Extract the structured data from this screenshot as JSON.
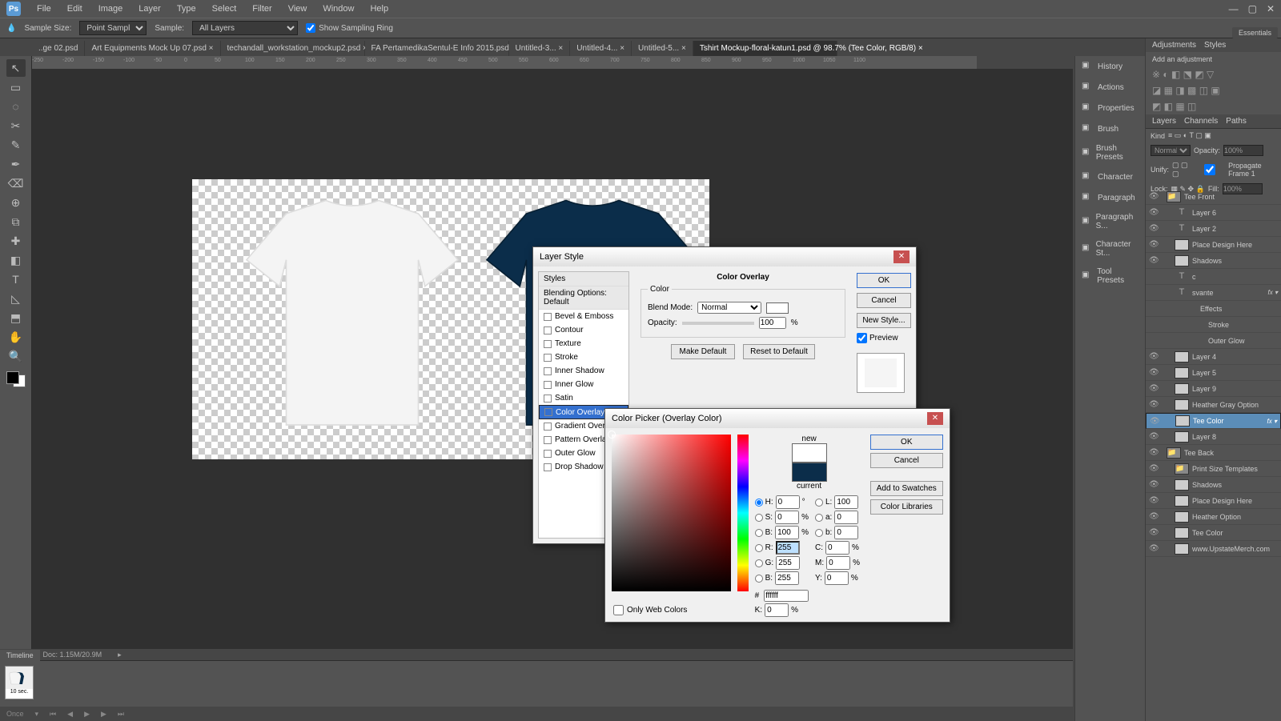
{
  "app": {
    "logo": "Ps"
  },
  "menu": [
    "File",
    "Edit",
    "Image",
    "Layer",
    "Type",
    "Select",
    "Filter",
    "View",
    "Window",
    "Help"
  ],
  "essentials": "Essentials",
  "options": {
    "sample_size_label": "Sample Size:",
    "sample_size": "Point Sample",
    "sample_label": "Sample:",
    "sample": "All Layers",
    "show_ring": "Show Sampling Ring"
  },
  "tabs": [
    "..ge 02.psd",
    "Art Equipments Mock Up 07.psd ×",
    "techandall_workstation_mockup2.psd ×",
    "FA PertamedikaSentul-E Info 2015.psd ×",
    "Untitled-3... ×",
    "Untitled-4... ×",
    "Untitled-5... ×",
    "Tshirt Mockup-floral-katun1.psd @ 98.7% (Tee Color, RGB/8) ×"
  ],
  "active_tab": 7,
  "ruler": [
    "-250",
    "-200",
    "-150",
    "-100",
    "-50",
    "0",
    "50",
    "100",
    "150",
    "200",
    "250",
    "300",
    "350",
    "400",
    "450",
    "500",
    "550",
    "600",
    "650",
    "700",
    "750",
    "800",
    "850",
    "900",
    "950",
    "1000",
    "1050",
    "1100"
  ],
  "status": {
    "zoom": "98.7%",
    "doc": "Doc: 1.15M/20.9M"
  },
  "timeline": {
    "label": "Timeline",
    "frame_time": "10 sec.",
    "mode": "Once"
  },
  "panel_items": [
    "History",
    "Actions",
    "Properties",
    "Brush",
    "Brush Presets",
    "Character",
    "Paragraph",
    "Paragraph S...",
    "Character St...",
    "Tool Presets"
  ],
  "adj": {
    "tabs": [
      "Adjustments",
      "Styles"
    ],
    "add": "Add an adjustment"
  },
  "layers_tabs": [
    "Layers",
    "Channels",
    "Paths"
  ],
  "layer_hdr": {
    "kind": "Kind",
    "mode": "Normal",
    "opacity_label": "Opacity:",
    "opacity": "100%",
    "unify": "Unify:",
    "propagate": "Propagate Frame 1",
    "lock": "Lock:",
    "fill_label": "Fill:",
    "fill": "100%"
  },
  "layers": [
    {
      "eye": "👁",
      "type": "folder",
      "name": "Tee Front",
      "indent": 0
    },
    {
      "eye": "👁",
      "type": "T",
      "name": "Layer 6",
      "indent": 1
    },
    {
      "eye": "👁",
      "type": "T",
      "name": "Layer 2",
      "indent": 1
    },
    {
      "eye": "👁",
      "type": "thumb",
      "name": "Place Design Here",
      "indent": 1
    },
    {
      "eye": "👁",
      "type": "thumb",
      "name": "Shadows",
      "indent": 1
    },
    {
      "eye": "",
      "type": "T",
      "name": "c",
      "indent": 1
    },
    {
      "eye": "",
      "type": "T",
      "name": "svante",
      "indent": 1,
      "fx": "fx"
    },
    {
      "eye": "",
      "type": "fx",
      "name": "Effects",
      "indent": 2
    },
    {
      "eye": "",
      "type": "fx",
      "name": "Stroke",
      "indent": 3
    },
    {
      "eye": "",
      "type": "fx",
      "name": "Outer Glow",
      "indent": 3
    },
    {
      "eye": "👁",
      "type": "thumb",
      "name": "Layer 4",
      "indent": 1
    },
    {
      "eye": "👁",
      "type": "thumb",
      "name": "Layer 5",
      "indent": 1
    },
    {
      "eye": "👁",
      "type": "thumb",
      "name": "Layer 9",
      "indent": 1
    },
    {
      "eye": "👁",
      "type": "thumb",
      "name": "Heather Gray Option",
      "indent": 1
    },
    {
      "eye": "👁",
      "type": "thumb",
      "name": "Tee Color",
      "indent": 1,
      "sel": true,
      "fx": "fx"
    },
    {
      "eye": "👁",
      "type": "thumb",
      "name": "Layer 8",
      "indent": 1
    },
    {
      "eye": "👁",
      "type": "folder",
      "name": "Tee Back",
      "indent": 0
    },
    {
      "eye": "👁",
      "type": "folder",
      "name": "Print Size Templates",
      "indent": 1
    },
    {
      "eye": "👁",
      "type": "thumb",
      "name": "Shadows",
      "indent": 1
    },
    {
      "eye": "👁",
      "type": "thumb",
      "name": "Place Design Here",
      "indent": 1
    },
    {
      "eye": "👁",
      "type": "thumb",
      "name": "Heather Option",
      "indent": 1
    },
    {
      "eye": "👁",
      "type": "thumb",
      "name": "Tee Color",
      "indent": 1
    },
    {
      "eye": "👁",
      "type": "thumb",
      "name": "www.UpstateMerch.com",
      "indent": 1
    }
  ],
  "layerstyle": {
    "title": "Layer Style",
    "styles_hdr": "Styles",
    "blending_hdr": "Blending Options: Default",
    "items": [
      "Bevel & Emboss",
      "Contour",
      "Texture",
      "Stroke",
      "Inner Shadow",
      "Inner Glow",
      "Satin",
      "Color Overlay",
      "Gradient Overlay",
      "Pattern Overlay",
      "Outer Glow",
      "Drop Shadow"
    ],
    "selected": "Color Overlay",
    "section_title": "Color Overlay",
    "group_title": "Color",
    "blend_label": "Blend Mode:",
    "blend_value": "Normal",
    "opacity_label": "Opacity:",
    "opacity_value": "100",
    "opacity_unit": "%",
    "make_default": "Make Default",
    "reset_default": "Reset to Default",
    "ok": "OK",
    "cancel": "Cancel",
    "new_style": "New Style...",
    "preview": "Preview"
  },
  "colorpicker": {
    "title": "Color Picker (Overlay Color)",
    "new": "new",
    "current": "current",
    "ok": "OK",
    "cancel": "Cancel",
    "add_swatches": "Add to Swatches",
    "color_libraries": "Color Libraries",
    "H": "0",
    "H_u": "°",
    "S": "0",
    "S_u": "%",
    "Bv": "100",
    "Bv_u": "%",
    "R": "255",
    "G": "255",
    "B2": "255",
    "L": "100",
    "a": "0",
    "b": "0",
    "C": "0",
    "C_u": "%",
    "M": "0",
    "M_u": "%",
    "Y": "0",
    "Y_u": "%",
    "K": "0",
    "K_u": "%",
    "hex_label": "#",
    "hex": "ffffff",
    "only_web": "Only Web Colors",
    "new_color": "#ffffff",
    "current_color": "#0b2d4a"
  },
  "tool_icons": [
    "↖",
    "▭",
    "◌",
    "✂",
    "✎",
    "✒",
    "⌫",
    "⊕",
    "⧉",
    "✚",
    "◧",
    "T",
    "◺",
    "⬒",
    "✋",
    "🔍"
  ]
}
